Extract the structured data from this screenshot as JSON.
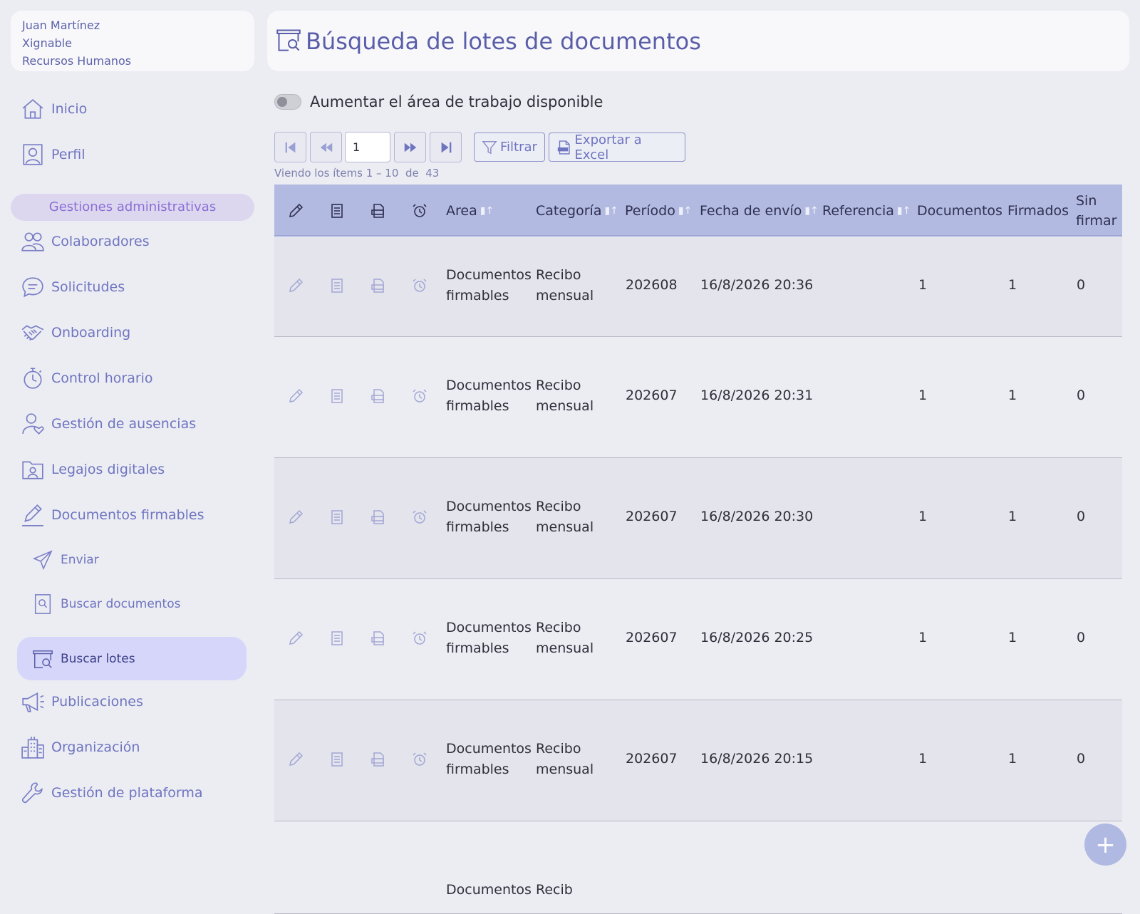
{
  "user": {
    "name": "Juan Martínez",
    "company": "Xignable",
    "department": "Recursos Humanos"
  },
  "sidebar": {
    "items": [
      {
        "label": "Inicio",
        "icon": "home-icon"
      },
      {
        "label": "Perfil",
        "icon": "profile-icon"
      },
      {
        "label": "Colaboradores",
        "icon": "users-icon"
      },
      {
        "label": "Solicitudes",
        "icon": "chat-icon"
      },
      {
        "label": "Onboarding",
        "icon": "handshake-icon"
      },
      {
        "label": "Control horario",
        "icon": "stopwatch-icon"
      },
      {
        "label": "Gestión de ausencias",
        "icon": "user-heart-icon"
      },
      {
        "label": "Legajos digitales",
        "icon": "folder-user-icon"
      },
      {
        "label": "Documentos firmables",
        "icon": "pen-icon"
      },
      {
        "label": "Publicaciones",
        "icon": "megaphone-icon"
      },
      {
        "label": "Organización",
        "icon": "buildings-icon"
      },
      {
        "label": "Gestión de plataforma",
        "icon": "wrench-icon"
      }
    ],
    "section_label": "Gestiones administrativas",
    "subitems": [
      {
        "label": "Enviar",
        "icon": "send-icon"
      },
      {
        "label": "Buscar documentos",
        "icon": "doc-search-icon"
      },
      {
        "label": "Buscar lotes",
        "icon": "batch-search-icon",
        "active": true
      }
    ]
  },
  "header": {
    "title": "Búsqueda de lotes de documentos",
    "icon": "batch-search-icon"
  },
  "toggle": {
    "label": "Aumentar el área de trabajo disponible",
    "on": false
  },
  "pager": {
    "page": "1",
    "filter_label": "Filtrar",
    "export_label": "Exportar a Excel"
  },
  "viewing": {
    "prefix": "Viendo los ítems",
    "range": "1 – 10",
    "of": "de",
    "total": "43"
  },
  "table": {
    "columns": [
      "Area",
      "Categoría",
      "Período",
      "Fecha de envío",
      "Referencia",
      "Documentos",
      "Firmados",
      "Sin",
      "firmar"
    ],
    "rows": [
      {
        "area1": "Documentos",
        "area2": "firmables",
        "cat1": "Recibo",
        "cat2": "mensual",
        "periodo": "202608",
        "fecha": "16/8/2026 20:36",
        "docs": "1",
        "firmados": "1",
        "sin": "0"
      },
      {
        "area1": "Documentos",
        "area2": "firmables",
        "cat1": "Recibo",
        "cat2": "mensual",
        "periodo": "202607",
        "fecha": "16/8/2026 20:31",
        "docs": "1",
        "firmados": "1",
        "sin": "0"
      },
      {
        "area1": "Documentos",
        "area2": "firmables",
        "cat1": "Recibo",
        "cat2": "mensual",
        "periodo": "202607",
        "fecha": "16/8/2026 20:30",
        "docs": "1",
        "firmados": "1",
        "sin": "0"
      },
      {
        "area1": "Documentos",
        "area2": "firmables",
        "cat1": "Recibo",
        "cat2": "mensual",
        "periodo": "202607",
        "fecha": "16/8/2026 20:25",
        "docs": "1",
        "firmados": "1",
        "sin": "0"
      },
      {
        "area1": "Documentos",
        "area2": "firmables",
        "cat1": "Recibo",
        "cat2": "mensual",
        "periodo": "202607",
        "fecha": "16/8/2026 20:15",
        "docs": "1",
        "firmados": "1",
        "sin": "0"
      },
      {
        "area1": "Documentos",
        "cat1": "Recib"
      }
    ]
  },
  "fab_label": "+",
  "colors": {
    "accent": "#6f74c0",
    "header_bg": "#b3bae2",
    "active_bg": "#d6d6fa",
    "section_bg": "#dcd7ef"
  }
}
